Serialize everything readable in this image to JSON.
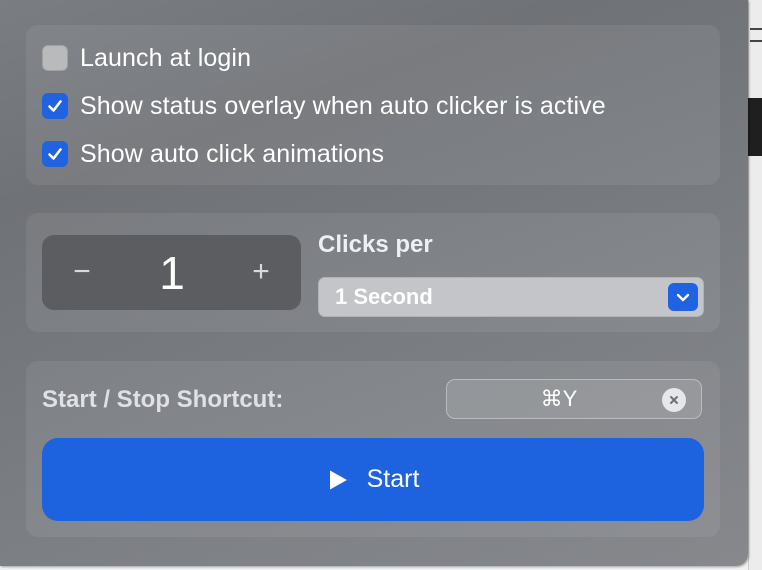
{
  "options": [
    {
      "label": "Launch at login",
      "checked": false
    },
    {
      "label": "Show status overlay when auto clicker is active",
      "checked": true
    },
    {
      "label": "Show auto click animations",
      "checked": true
    }
  ],
  "rate": {
    "minus_glyph": "−",
    "value": "1",
    "plus_glyph": "+",
    "clicks_label": "Clicks per",
    "period_selected": "1 Second"
  },
  "shortcut": {
    "label": "Start / Stop Shortcut:",
    "keys": "⌘Y"
  },
  "start_button": {
    "label": "Start",
    "icon": "play-icon"
  },
  "colors": {
    "accent": "#1f63e2",
    "panel": "#75787d"
  }
}
